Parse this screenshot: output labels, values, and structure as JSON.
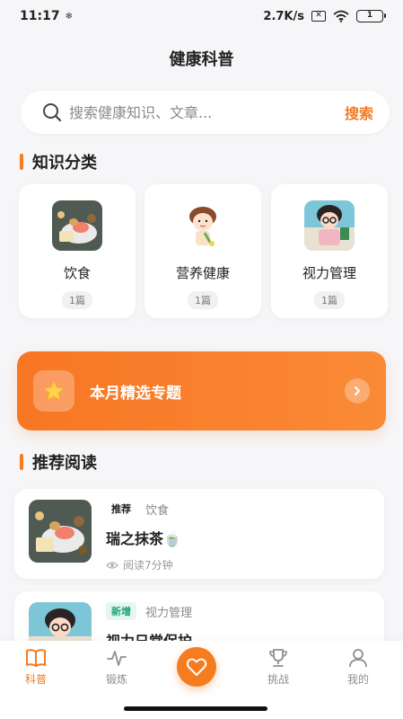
{
  "status": {
    "time": "11:17",
    "net_speed": "2.7K/s",
    "battery": "1"
  },
  "header": {
    "title": "健康科普"
  },
  "search": {
    "placeholder": "搜索健康知识、文章...",
    "button_label": "搜索"
  },
  "categories_section": {
    "title": "知识分类"
  },
  "categories": [
    {
      "name": "饮食",
      "count": "1篇"
    },
    {
      "name": "营养健康",
      "count": "1篇"
    },
    {
      "name": "视力管理",
      "count": "1篇"
    }
  ],
  "featured": {
    "label": "本月精选专题"
  },
  "recommend_section": {
    "title": "推荐阅读"
  },
  "articles": [
    {
      "badge": "推荐",
      "category": "饮食",
      "title": "瑞之抹茶🍵",
      "meta": "阅读7分钟"
    },
    {
      "badge": "新增",
      "category": "视力管理",
      "title": "视力日常保护"
    }
  ],
  "bottom_nav": {
    "items": [
      {
        "label": "科普",
        "icon": "book-icon",
        "active": true
      },
      {
        "label": "锻炼",
        "icon": "pulse-icon"
      },
      {
        "label": "",
        "icon": "heart-icon"
      },
      {
        "label": "挑战",
        "icon": "trophy-icon"
      },
      {
        "label": "我的",
        "icon": "user-icon"
      }
    ]
  },
  "colors": {
    "accent": "#f57c1f",
    "new_badge": "#1aa37a"
  }
}
